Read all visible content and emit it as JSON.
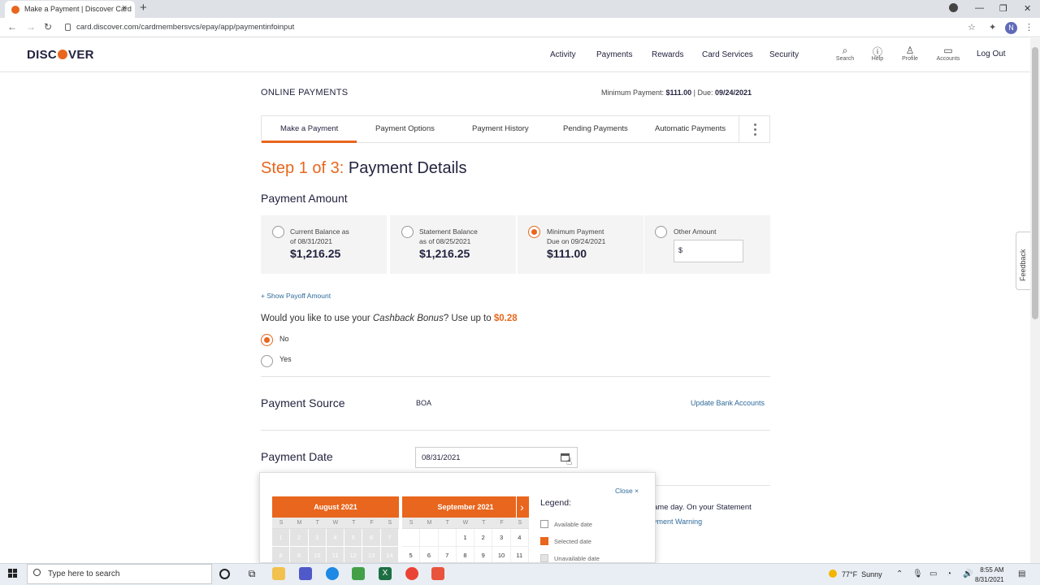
{
  "browser": {
    "tab_title": "Make a Payment | Discover Card",
    "tab_close": "×",
    "new_tab": "+",
    "url": "card.discover.com/cardmembersvcs/epay/app/paymentinfoinput",
    "avatar_letter": "N"
  },
  "header": {
    "logo_left": "DISC",
    "logo_right": "VER",
    "nav": [
      "Activity",
      "Payments",
      "Rewards",
      "Card Services",
      "Security"
    ],
    "icons": [
      {
        "label": "Search",
        "icon": "search-icon"
      },
      {
        "label": "Help",
        "icon": "help-icon"
      },
      {
        "label": "Profile",
        "icon": "profile-icon"
      },
      {
        "label": "Accounts",
        "icon": "accounts-icon"
      }
    ],
    "logout": "Log Out"
  },
  "page": {
    "section_title": "ONLINE PAYMENTS",
    "min_payment_label": "Minimum Payment:",
    "min_payment_value": "$111.00",
    "due_sep": "|",
    "due_label": "Due:",
    "due_value": "09/24/2021",
    "tabs": [
      "Make a Payment",
      "Payment Options",
      "Payment History",
      "Pending Payments",
      "Automatic Payments"
    ],
    "step_num": "Step 1 of 3:",
    "step_title": "Payment Details",
    "payment_amount_heading": "Payment Amount",
    "amount_options": [
      {
        "line1": "Current Balance as",
        "line2": "of 08/31/2021",
        "amount": "$1,216.25",
        "selected": false
      },
      {
        "line1": "Statement Balance",
        "line2": "as of 08/25/2021",
        "amount": "$1,216.25",
        "selected": false
      },
      {
        "line1": "Minimum Payment",
        "line2": "Due on 09/24/2021",
        "amount": "$111.00",
        "selected": true
      },
      {
        "line1": "Other Amount",
        "line2": "",
        "amount": "",
        "selected": false
      }
    ],
    "other_amount_prefix": "$",
    "show_payoff": "+ Show Payoff Amount",
    "cashback_q1": "Would you like to use your ",
    "cashback_em": "Cashback Bonus",
    "cashback_q2": "? Use up to ",
    "cashback_amt": "$0.28",
    "cashback_options": [
      {
        "label": "No",
        "selected": true
      },
      {
        "label": "Yes",
        "selected": false
      }
    ],
    "payment_source_heading": "Payment Source",
    "payment_source_value": "BOA",
    "update_bank": "Update Bank Accounts",
    "payment_date_heading": "Payment Date",
    "payment_date_value": "08/31/2021",
    "partial_text_1": "ame day. On your Statement",
    "partial_text_2": "yment Warning"
  },
  "calendar": {
    "close_label": "Close",
    "close_x": "×",
    "dow": [
      "S",
      "M",
      "T",
      "W",
      "T",
      "F",
      "S"
    ],
    "months": [
      {
        "title": "August 2021",
        "weeks": [
          [
            "1",
            "2",
            "3",
            "4",
            "5",
            "6",
            "7"
          ],
          [
            "8",
            "9",
            "10",
            "11",
            "12",
            "13",
            "14"
          ]
        ]
      },
      {
        "title": "September 2021",
        "weeks": [
          [
            "",
            "",
            "",
            "1",
            "2",
            "3",
            "4"
          ],
          [
            "5",
            "6",
            "7",
            "8",
            "9",
            "10",
            "11"
          ]
        ]
      }
    ],
    "next_arrow": "›",
    "legend_title": "Legend:",
    "legend": [
      "Available date",
      "Selected date",
      "Unavailable date"
    ],
    "colors": {
      "selected": "#e8661d",
      "unavailable": "#e3e3e3",
      "available": "#ffffff"
    }
  },
  "feedback": "Feedback",
  "taskbar": {
    "search_placeholder": "Type here to search",
    "weather_temp": "77°F",
    "weather_desc": "Sunny",
    "time": "8:55 AM",
    "date": "8/31/2021"
  },
  "colors": {
    "accent": "#e8661d",
    "link": "#2f6b9a",
    "text": "#23233f"
  }
}
